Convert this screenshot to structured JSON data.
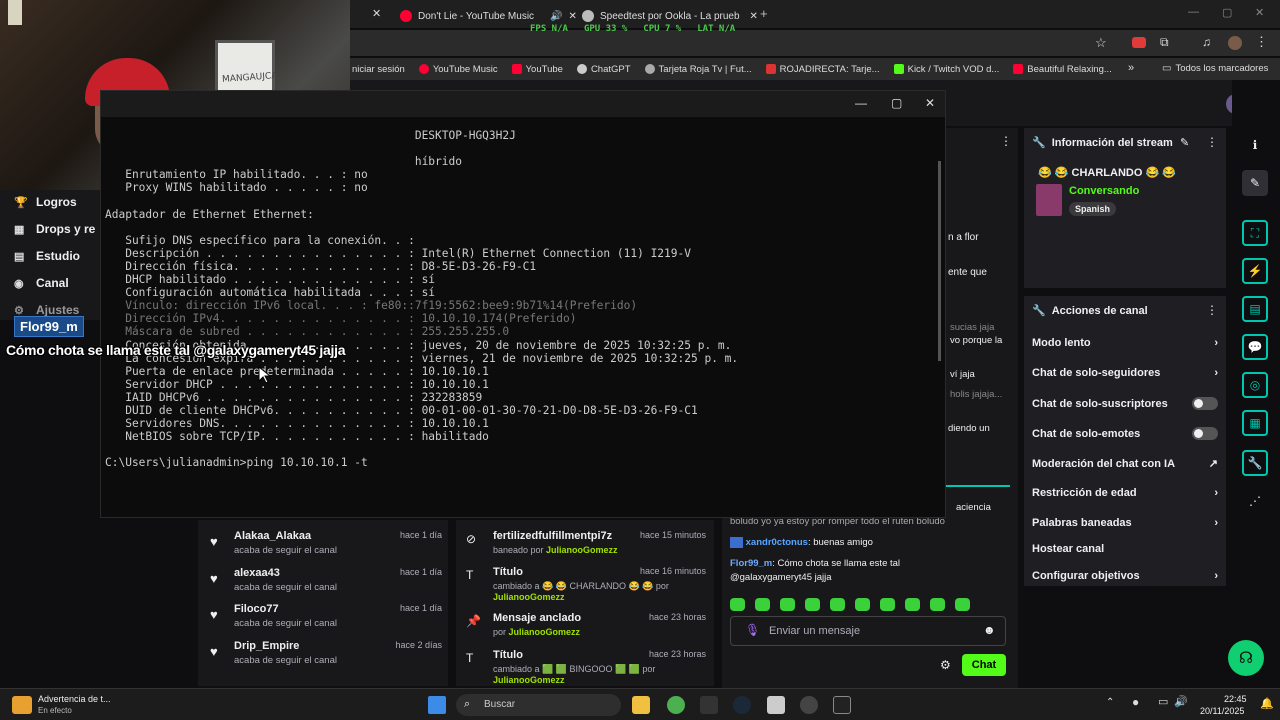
{
  "webcam": {
    "board_text": "MANGAUJCA"
  },
  "browser": {
    "tabs": [
      {
        "label": "Don't Lie - YouTube Music",
        "color": "#ff0033"
      },
      {
        "label": "Speedtest por Ookla - La prueb",
        "color": "#bbbbbb"
      }
    ],
    "stats": {
      "fps": "FPS N/A",
      "gpu": "GPU 33 %",
      "cpu": "CPU 7 %",
      "lat": "LAT N/A"
    },
    "bookmarks": [
      "niciar sesión",
      "YouTube Music",
      "YouTube",
      "ChatGPT",
      "Tarjeta Roja Tv | Fut...",
      "ROJADIRECTA: Tarje...",
      "Kick / Twitch VOD d...",
      "Beautiful Relaxing..."
    ],
    "all_bookmarks": "Todos los marcadores"
  },
  "leftnav": {
    "items": [
      {
        "icon": "trophy-icon",
        "label": "Logros"
      },
      {
        "icon": "drops-icon",
        "label": "Drops y re"
      },
      {
        "icon": "studio-icon",
        "label": "Estudio"
      },
      {
        "icon": "channel-icon",
        "label": "Canal"
      },
      {
        "icon": "settings-icon",
        "label": "Ajustes"
      }
    ]
  },
  "terminal": {
    "lines": [
      "                                              DESKTOP-HGQ3H2J",
      "",
      "                                              híbrido",
      "   Enrutamiento IP habilitado. . . : no",
      "   Proxy WINS habilitado . . . . . : no",
      "",
      "Adaptador de Ethernet Ethernet:",
      "",
      "   Sufijo DNS específico para la conexión. . :",
      "   Descripción . . . . . . . . . . . . . . . : Intel(R) Ethernet Connection (11) I219-V",
      "   Dirección física. . . . . . . . . . . . . : D8-5E-D3-26-F9-C1",
      "   DHCP habilitado . . . . . . . . . . . . . : sí",
      "   Configuración automática habilitada . . . : sí",
      "   Vínculo: dirección IPv6 local. . . : fe80::7f19:5562:bee9:9b71%14(Preferido)",
      "   Dirección IPv4. . . . . . . . . . . . . . : 10.10.10.174(Preferido)",
      "   Máscara de subred . . . . . . . . . . . . : 255.255.255.0",
      "   Concesión obtenida. . . . . . . . . . . . : jueves, 20 de noviembre de 2025 10:32:25 p. m.",
      "   La concesión expira . . . . . . . . . . . : viernes, 21 de noviembre de 2025 10:32:25 p. m.",
      "   Puerta de enlace predeterminada . . . . . : 10.10.10.1",
      "   Servidor DHCP . . . . . . . . . . . . . . : 10.10.10.1",
      "   IAID DHCPv6 . . . . . . . . . . . . . . . : 232283859",
      "   DUID de cliente DHCPv6. . . . . . . . . . : 00-01-00-01-30-70-21-D0-D8-5E-D3-26-F9-C1",
      "   Servidores DNS. . . . . . . . . . . . . . : 10.10.10.1",
      "   NetBIOS sobre TCP/IP. . . . . . . . . . . : habilitado",
      "",
      "C:\\Users\\julianadmin>ping 10.10.10.1 -t"
    ]
  },
  "overlay": {
    "name": "Flor99_m",
    "message": "Cómo chota se llama este tal @galaxygameryt45 jajja"
  },
  "stream_info": {
    "title": "Información del stream",
    "stream_title": "😂 😂 CHARLANDO 😂 😂",
    "category": "Conversando",
    "tag": "Spanish"
  },
  "channel_actions": {
    "title": "Acciones de canal",
    "rows": [
      {
        "label": "Modo lento",
        "kind": "chevron"
      },
      {
        "label": "Chat de solo-seguidores",
        "kind": "chevron"
      },
      {
        "label": "Chat de solo-suscriptores",
        "kind": "toggle"
      },
      {
        "label": "Chat de solo-emotes",
        "kind": "toggle"
      },
      {
        "label": "Moderación del chat con IA",
        "kind": "chart"
      },
      {
        "label": "Restricción de edad",
        "kind": "chevron"
      },
      {
        "label": "Palabras baneadas",
        "kind": "chevron"
      },
      {
        "label": "Hostear canal",
        "kind": "none"
      },
      {
        "label": "Configurar objetivos",
        "kind": "chevron"
      }
    ]
  },
  "chat": {
    "fragments": [
      "n a flor",
      "ente que",
      "sucias jaja",
      "vo porque la",
      "ví jaja",
      "holis jajaja...",
      "diendo un",
      "aciencia",
      "boludo yo ya estoy por romper todo el ruten boludo"
    ],
    "messages": [
      {
        "user": "xandr0ctonus",
        "color": "#58a6ff",
        "text": ": buenas amigo"
      },
      {
        "user": "Flor99_m",
        "color": "#6fa8ff",
        "text": ": Cómo chota se llama este tal @galaxygameryt45 jajja"
      }
    ],
    "input_placeholder": "Enviar un mensaje",
    "send_label": "Chat"
  },
  "followers": [
    {
      "name": "Alakaa_Alakaa",
      "sub": "acaba de seguir el canal",
      "ago": "hace 1 día"
    },
    {
      "name": "alexaa43",
      "sub": "acaba de seguir el canal",
      "ago": "hace 1 día"
    },
    {
      "name": "Filoco77",
      "sub": "acaba de seguir el canal",
      "ago": "hace 1 día"
    },
    {
      "name": "Drip_Empire",
      "sub": "acaba de seguir el canal",
      "ago": "hace 2 días"
    }
  ],
  "modlog": [
    {
      "icon": "ban-icon",
      "title": "fertilizedfulfillmentpi7z",
      "sub_prefix": "baneado por ",
      "sub_user": "JulianooGomezz",
      "ago": "hace 15 minutos"
    },
    {
      "icon": "title-icon",
      "title": "Título",
      "sub_prefix": "cambiado a 😂 😂 CHARLANDO 😂 😂 por ",
      "sub_user": "JulianooGomezz",
      "ago": "hace 16 minutos"
    },
    {
      "icon": "pin-icon",
      "title": "Mensaje anclado",
      "sub_prefix": "por ",
      "sub_user": "JulianooGomezz",
      "ago": "hace 23 horas"
    },
    {
      "icon": "title-icon",
      "title": "Título",
      "sub_prefix": "cambiado a 🟩 🟩 BINGOOO 🟩 🟩 por",
      "sub_user": "JulianooGomezz",
      "ago": "hace 23 horas"
    }
  ],
  "taskbar": {
    "alert_title": "Advertencia de t...",
    "alert_sub": "En efecto",
    "search_placeholder": "Buscar",
    "time": "22:45",
    "date": "20/11/2025"
  }
}
